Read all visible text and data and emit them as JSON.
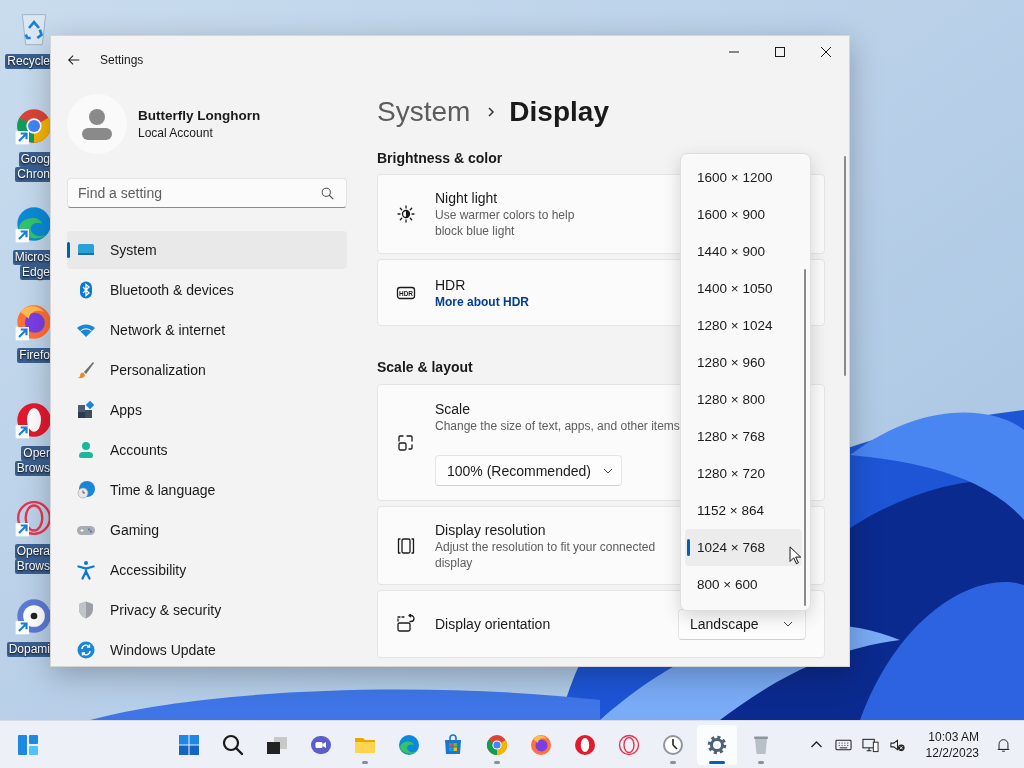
{
  "desktop_icons": [
    {
      "label_lines": [
        "Recycle"
      ]
    },
    {
      "label_lines": [
        "Goog",
        "Chron"
      ]
    },
    {
      "label_lines": [
        "Micros",
        "Edge"
      ]
    },
    {
      "label_lines": [
        "Firefo"
      ]
    },
    {
      "label_lines": [
        "Oper",
        "Brows"
      ]
    },
    {
      "label_lines": [
        "Opera",
        "Brows"
      ]
    },
    {
      "label_lines": [
        "Dopami"
      ]
    }
  ],
  "window": {
    "title": "Settings"
  },
  "profile": {
    "name": "Butterfly Longhorn",
    "account": "Local Account"
  },
  "search": {
    "placeholder": "Find a setting"
  },
  "sidebar": {
    "items": [
      {
        "label": "System",
        "selected": true
      },
      {
        "label": "Bluetooth & devices",
        "selected": false
      },
      {
        "label": "Network & internet",
        "selected": false
      },
      {
        "label": "Personalization",
        "selected": false
      },
      {
        "label": "Apps",
        "selected": false
      },
      {
        "label": "Accounts",
        "selected": false
      },
      {
        "label": "Time & language",
        "selected": false
      },
      {
        "label": "Gaming",
        "selected": false
      },
      {
        "label": "Accessibility",
        "selected": false
      },
      {
        "label": "Privacy & security",
        "selected": false
      },
      {
        "label": "Windows Update",
        "selected": false
      }
    ]
  },
  "breadcrumb": {
    "parent": "System",
    "current": "Display"
  },
  "sections": [
    {
      "heading": "Brightness & color",
      "cards": [
        {
          "kind": "toggle",
          "title": "Night light",
          "description": "Use warmer colors to help block blue light"
        },
        {
          "kind": "link",
          "title": "HDR",
          "icon_text": "HDR",
          "link": "More about HDR"
        }
      ]
    },
    {
      "heading": "Scale & layout",
      "cards": [
        {
          "kind": "dropdown-below",
          "title": "Scale",
          "description": "Change the size of text, apps, and other items",
          "value": "100% (Recommended)"
        },
        {
          "kind": "menu-open",
          "title": "Display resolution",
          "description": "Adjust the resolution to fit your connected display"
        },
        {
          "kind": "dropdown",
          "title": "Display orientation",
          "value": "Landscape"
        }
      ]
    }
  ],
  "resolution_menu": {
    "items": [
      {
        "label": "1600 × 1200",
        "selected": false
      },
      {
        "label": "1600 × 900",
        "selected": false
      },
      {
        "label": "1440 × 900",
        "selected": false
      },
      {
        "label": "1400 × 1050",
        "selected": false
      },
      {
        "label": "1280 × 1024",
        "selected": false
      },
      {
        "label": "1280 × 960",
        "selected": false
      },
      {
        "label": "1280 × 800",
        "selected": false
      },
      {
        "label": "1280 × 768",
        "selected": false
      },
      {
        "label": "1280 × 720",
        "selected": false
      },
      {
        "label": "1152 × 864",
        "selected": false
      },
      {
        "label": "1024 × 768",
        "selected": true
      },
      {
        "label": "800 × 600",
        "selected": false
      }
    ]
  },
  "taskbar": {
    "apps": [
      {
        "running": false,
        "active": false
      },
      {
        "running": false,
        "active": false
      },
      {
        "running": false,
        "active": false
      },
      {
        "running": false,
        "active": false
      },
      {
        "running": true,
        "active": false
      },
      {
        "running": false,
        "active": false
      },
      {
        "running": false,
        "active": false
      },
      {
        "running": true,
        "active": false
      },
      {
        "running": false,
        "active": false
      },
      {
        "running": false,
        "active": false
      },
      {
        "running": false,
        "active": false
      },
      {
        "running": true,
        "active": false
      },
      {
        "running": true,
        "active": true
      },
      {
        "running": true,
        "active": false
      }
    ],
    "time": "10:03 AM",
    "date": "12/2/2023"
  }
}
